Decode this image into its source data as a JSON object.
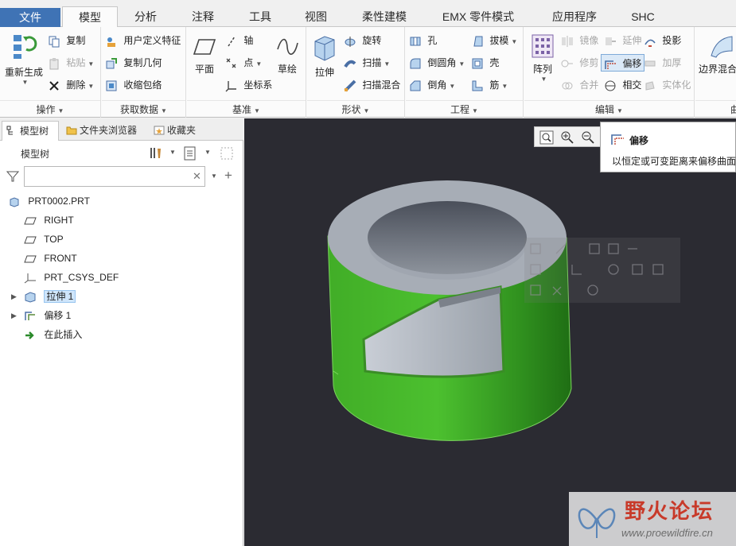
{
  "tabs": {
    "file": "文件",
    "model": "模型",
    "analysis": "分析",
    "annotate": "注释",
    "tools": "工具",
    "view": "视图",
    "flexible": "柔性建模",
    "emx": "EMX 零件模式",
    "apps": "应用程序",
    "shc": "SHC"
  },
  "ribbon": {
    "operations": {
      "regenerate": "重新生成",
      "copy": "复制",
      "paste": "粘贴",
      "delete": "删除",
      "label": "操作"
    },
    "getdata": {
      "udf": "用户定义特征",
      "copy_geom": "复制几何",
      "shrinkwrap": "收缩包络",
      "label": "获取数据"
    },
    "datum": {
      "plane": "平面",
      "axis": "轴",
      "point": "点",
      "csys": "坐标系",
      "sketch": "草绘",
      "label": "基准"
    },
    "shapes": {
      "extrude": "拉伸",
      "revolve": "旋转",
      "sweep": "扫描",
      "swept_blend": "扫描混合",
      "label": "形状"
    },
    "engineering": {
      "hole": "孔",
      "round": "倒圆角",
      "chamfer": "倒角",
      "draft": "拔模",
      "shell": "壳",
      "rib": "筋",
      "label": "工程"
    },
    "editing": {
      "pattern": "阵列",
      "mirror": "镜像",
      "extend": "延伸",
      "project": "投影",
      "trim": "修剪",
      "offset": "偏移",
      "thicken": "加厚",
      "merge": "合并",
      "intersect": "相交",
      "solidify": "实体化",
      "label": "编辑"
    },
    "surfaces": {
      "boundary_blend": "边界混合",
      "label_partial": "曲"
    }
  },
  "panel": {
    "tabs": {
      "model_tree": "模型树",
      "folder_browser": "文件夹浏览器",
      "favorites": "收藏夹"
    },
    "tree_title": "模型树",
    "filter_value": ""
  },
  "tree": [
    {
      "label": "PRT0002.PRT",
      "icon": "part-icon"
    },
    {
      "label": "RIGHT",
      "icon": "datum-plane-icon"
    },
    {
      "label": "TOP",
      "icon": "datum-plane-icon"
    },
    {
      "label": "FRONT",
      "icon": "datum-plane-icon"
    },
    {
      "label": "PRT_CSYS_DEF",
      "icon": "csys-icon"
    },
    {
      "label": "拉伸 1",
      "icon": "extrude-icon",
      "selected": true
    },
    {
      "label": "偏移 1",
      "icon": "offset-icon"
    },
    {
      "label": "在此插入",
      "icon": "insert-arrow-icon"
    }
  ],
  "tooltip": {
    "title": "偏移",
    "description": "以恒定或可变距离来偏移曲面"
  },
  "watermark": {
    "title": "野火论坛",
    "url": "www.proewildfire.cn"
  },
  "colors": {
    "file_tab": "#3f73b5",
    "model_green": "#3fb12a",
    "model_gray": "#a7adb6",
    "viewport_bg": "#2b2b32",
    "selection": "#cfe5fb"
  }
}
